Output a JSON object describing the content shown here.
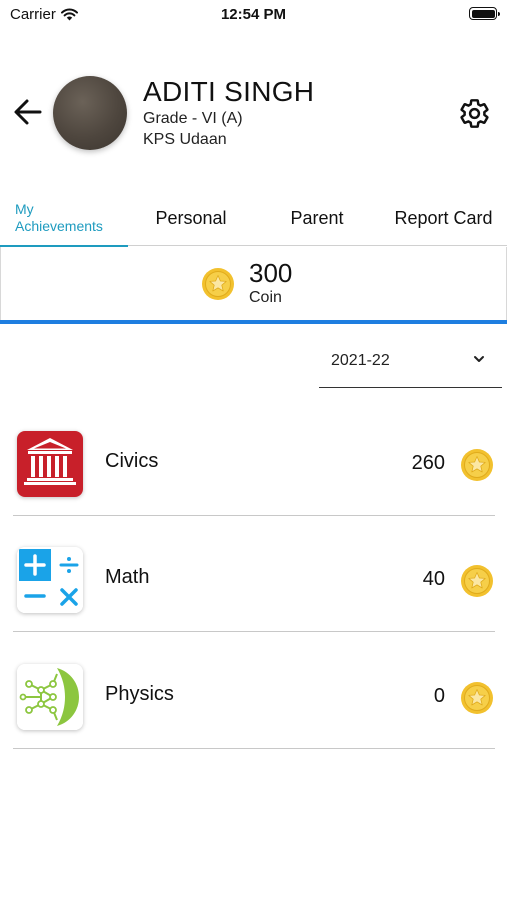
{
  "status_bar": {
    "carrier": "Carrier",
    "time": "12:54 PM"
  },
  "profile": {
    "name": "ADITI SINGH",
    "grade": "Grade - VI (A)",
    "school": "KPS Udaan"
  },
  "tabs": [
    {
      "label_line1": "My",
      "label_line2": "Achievements",
      "active": true
    },
    {
      "label": "Personal",
      "active": false
    },
    {
      "label": "Parent",
      "active": false
    },
    {
      "label": "Report Card",
      "active": false
    }
  ],
  "coins": {
    "total": "300",
    "label": "Coin"
  },
  "year_selector": {
    "value": "2021-22"
  },
  "subjects": [
    {
      "name": "Civics",
      "coins": "260",
      "icon": "civics-building-icon"
    },
    {
      "name": "Math",
      "coins": "40",
      "icon": "math-operators-icon"
    },
    {
      "name": "Physics",
      "coins": "0",
      "icon": "physics-network-icon"
    }
  ],
  "colors": {
    "accent": "#1e9bbf",
    "coin_bar": "#1e7ee0",
    "coin_gold": "#f2c12e",
    "civics_red": "#c8202a",
    "math_blue": "#1aa3e8",
    "physics_green": "#8cc63f"
  }
}
